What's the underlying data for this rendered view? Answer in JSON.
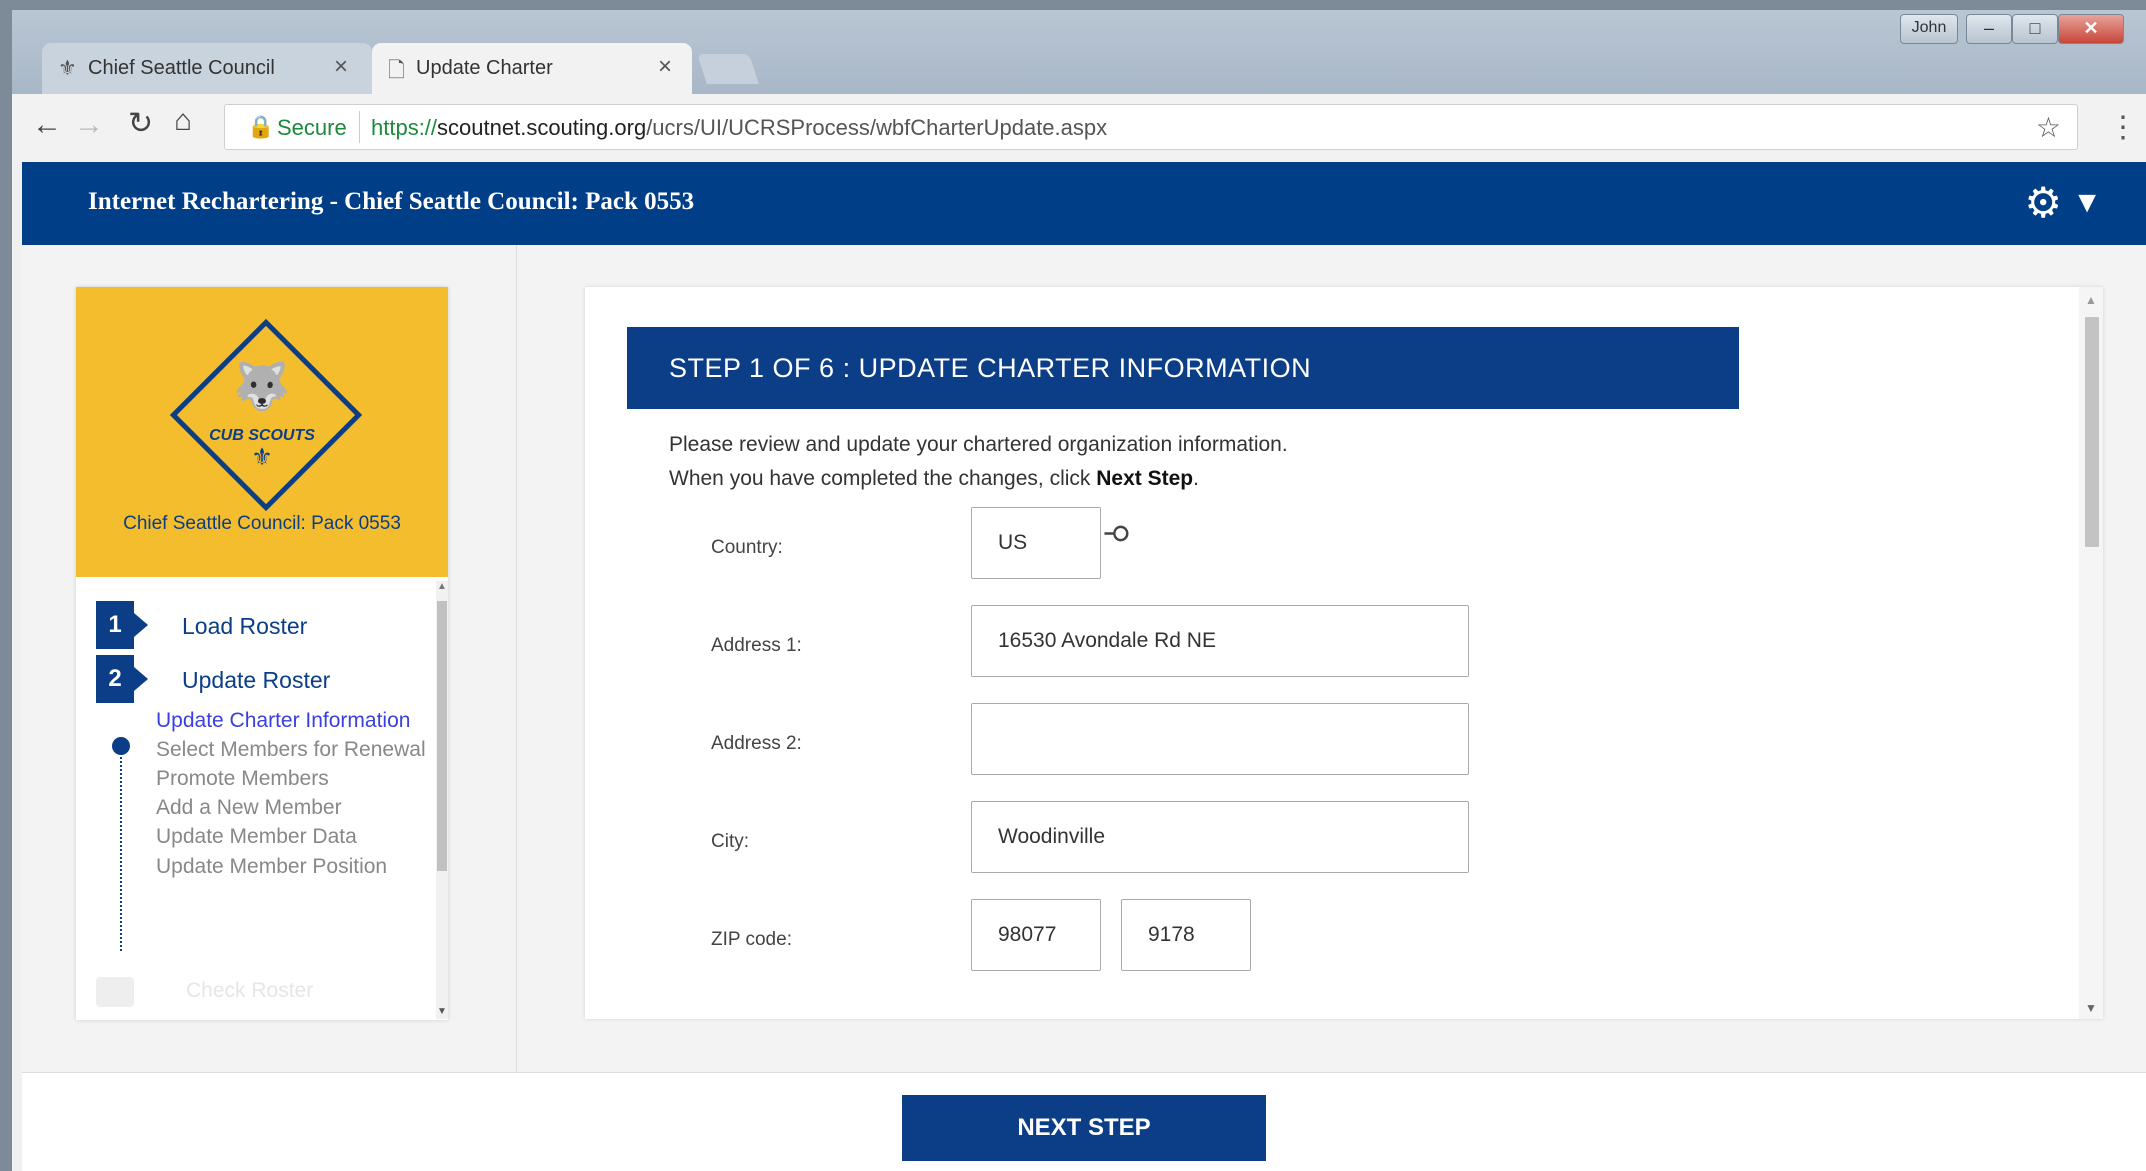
{
  "browser": {
    "tabs": [
      {
        "title": "Chief Seattle Council",
        "icon": "scout-emblem-icon"
      },
      {
        "title": "Update Charter",
        "icon": "page-icon"
      }
    ],
    "user_badge": "John",
    "secure_label": "Secure",
    "url_scheme": "https://",
    "url_host": "scoutnet.scouting.org",
    "url_path": "/ucrs/UI/UCRSProcess/wbfCharterUpdate.aspx"
  },
  "app": {
    "title": "Internet Rechartering - Chief Seattle Council: Pack 0553",
    "brand_color": "#0b3e86",
    "accent_color": "#f3bd2e"
  },
  "sidebar": {
    "unit_name": "Chief Seattle Council: Pack 0553",
    "logo_text": "CUB SCOUTS",
    "steps": [
      {
        "number": "1",
        "label": "Load Roster"
      },
      {
        "number": "2",
        "label": "Update Roster"
      }
    ],
    "subitems": [
      "Update Charter Information",
      "Select Members for Renewal",
      "Promote Members",
      "Add a New Member",
      "Update Member Data",
      "Update Member Position"
    ],
    "next_step_label": "Check Roster"
  },
  "main": {
    "step_title": "STEP 1 OF 6 : UPDATE CHARTER INFORMATION",
    "instruction_line1": "Please review and update your chartered organization information.",
    "instruction_line2_prefix": "When you have completed the changes, click ",
    "instruction_line2_bold": "Next Step",
    "instruction_line2_suffix": ".",
    "fields": {
      "country": {
        "label": "Country:",
        "value": "US"
      },
      "address1": {
        "label": "Address 1:",
        "value": "16530 Avondale Rd NE"
      },
      "address2": {
        "label": "Address 2:",
        "value": ""
      },
      "city": {
        "label": "City:",
        "value": "Woodinville"
      },
      "zip": {
        "label": "ZIP code:",
        "value": "98077",
        "ext": "9178"
      }
    }
  },
  "footer": {
    "next_button": "NEXT STEP"
  }
}
